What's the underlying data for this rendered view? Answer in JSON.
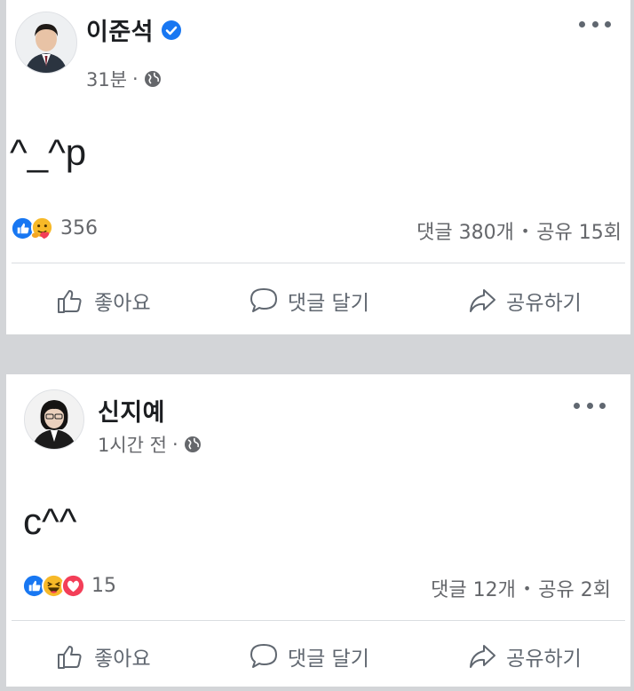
{
  "posts": [
    {
      "author": "이준석",
      "verified": true,
      "time": "31분",
      "separator": "·",
      "privacy_icon": "globe-icon",
      "text": "^_^p",
      "reactions": [
        "like-reaction-icon",
        "care-reaction-icon"
      ],
      "reaction_count": "356",
      "comments": "댓글 380개",
      "dot": "•",
      "shares": "공유 15회"
    },
    {
      "author": "신지예",
      "verified": false,
      "time": "1시간 전",
      "separator": "·",
      "privacy_icon": "globe-icon",
      "text": "c^^",
      "reactions": [
        "like-reaction-icon",
        "haha-reaction-icon",
        "love-reaction-icon"
      ],
      "reaction_count": "15",
      "comments": "댓글 12개",
      "dot": "•",
      "shares": "공유 2회"
    }
  ],
  "actions": {
    "like": "좋아요",
    "comment": "댓글 달기",
    "share": "공유하기"
  },
  "colors": {
    "facebook_blue": "#1877f2",
    "love_red": "#f33e58",
    "emoji_yellow": "#f7b928",
    "secondary_text": "#65676b"
  }
}
